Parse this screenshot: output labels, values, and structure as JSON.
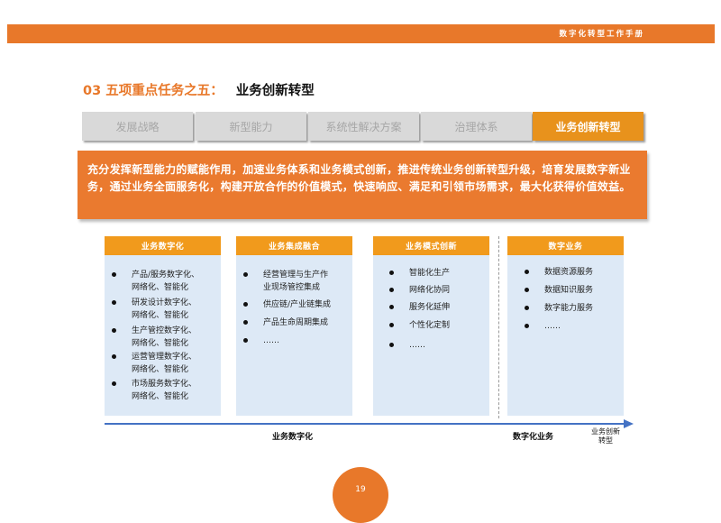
{
  "header": {
    "doc_title": "数字化转型工作手册"
  },
  "section": {
    "number": "03 五项重点任务之五：",
    "subtitle": "业务创新转型"
  },
  "tabs": [
    "发展战略",
    "新型能力",
    "系统性解决方案",
    "治理体系",
    "业务创新转型"
  ],
  "active_tab_index": 4,
  "banner": {
    "text": "充分发挥新型能力的赋能作用，加速业务体系和业务模式创新，推进传统业务创新转型升级，培育发展数字新业务，通过业务全面服务化，构建开放合作的价值模式，快速响应、满足和引领市场需求，最大化获得价值效益。"
  },
  "columns": [
    {
      "title": "业务数字化",
      "items": [
        [
          "产品/服务数字化、",
          "网络化、智能化"
        ],
        [
          "研发设计数字化、",
          "网络化、智能化"
        ],
        [
          "生产管控数字化、",
          "网络化、智能化"
        ],
        [
          "运营管理数字化、",
          "网络化、智能化"
        ],
        [
          "市场服务数字化、",
          "网络化、智能化"
        ]
      ]
    },
    {
      "title": "业务集成融合",
      "items": [
        [
          "经营管理与生产作",
          "业现场管控集成"
        ],
        [
          "供应链/产业链集成"
        ],
        [
          "产品生命周期集成"
        ],
        [
          "……"
        ]
      ]
    },
    {
      "title": "业务模式创新",
      "items": [
        [
          "智能化生产"
        ],
        [
          "网络化协同"
        ],
        [
          "服务化延伸"
        ],
        [
          "个性化定制"
        ],
        [
          "……"
        ]
      ]
    },
    {
      "title": "数字业务",
      "items": [
        [
          "数据资源服务"
        ],
        [
          "数据知识服务"
        ],
        [
          "数字能力服务"
        ],
        [
          "……"
        ]
      ]
    }
  ],
  "axis": {
    "left_label": "业务数字化",
    "right_label": "数字化业务",
    "end_label": [
      "业务创新",
      "转型"
    ]
  },
  "page": {
    "number": "19"
  },
  "colors": {
    "accent": "#e8782a",
    "column_head": "#f19a1c",
    "column_bg": "#dde9f6",
    "axis": "#4472c4"
  }
}
